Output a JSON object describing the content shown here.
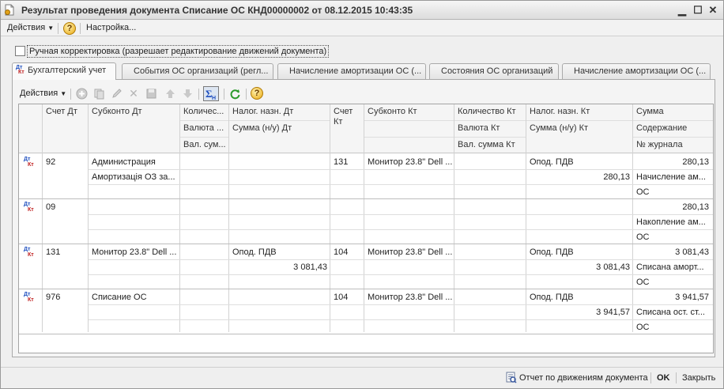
{
  "window": {
    "title": "Результат проведения документа Списание ОС КНД00000002 от 08.12.2015 10:43:35"
  },
  "menubar": {
    "actions_label": "Действия",
    "settings_label": "Настройка..."
  },
  "manual_edit": {
    "label": "Ручная корректировка (разрешает редактирование движений документа)",
    "checked": false
  },
  "tabs": [
    {
      "label": "Бухгалтерский учет",
      "active": true
    },
    {
      "label": "События ОС организаций (регл...",
      "active": false
    },
    {
      "label": "Начисление амортизации ОС (...",
      "active": false
    },
    {
      "label": "Состояния ОС организаций",
      "active": false
    },
    {
      "label": "Начисление амортизации ОС (...",
      "active": false
    }
  ],
  "toolbar": {
    "actions_label": "Действия"
  },
  "table": {
    "headers": {
      "schet_dt": "Счет Дт",
      "subkonto_dt": "Субконто Дт",
      "kolichestvo_dt": "Количес...",
      "valyuta_dt": "Валюта ...",
      "val_summa_dt": "Вал. сум...",
      "nalog_dt": "Налог. назн. Дт",
      "summa_nu_dt": "Сумма (н/у) Дт",
      "schet_kt_1": "Счет",
      "schet_kt_2": "Кт",
      "subkonto_kt": "Субконто Кт",
      "kolichestvo_kt": "Количество Кт",
      "valyuta_kt": "Валюта Кт",
      "val_summa_kt": "Вал. сумма Кт",
      "nalog_kt": "Налог. назн. Кт",
      "summa_nu_kt": "Сумма (н/у) Кт",
      "summa": "Сумма",
      "soderzhanie": "Содержание",
      "nomer_zhurnala": "№ журнала"
    },
    "rows": [
      {
        "schet_dt": "92",
        "subkonto_dt_1": "Администрация",
        "subkonto_dt_2": "Амортизація ОЗ за...",
        "nalog_dt": "",
        "summa_nu_dt": "",
        "schet_kt": "131",
        "subkonto_kt": "Монитор 23.8\" Dell ...",
        "nalog_kt": "Опод. ПДВ",
        "summa_nu_kt": "280,13",
        "summa": "280,13",
        "soderzhanie": "Начисление ам...",
        "zhurnal": "ОС"
      },
      {
        "schet_dt": "09",
        "subkonto_dt_1": "",
        "subkonto_dt_2": "",
        "nalog_dt": "",
        "summa_nu_dt": "",
        "schet_kt": "",
        "subkonto_kt": "",
        "nalog_kt": "",
        "summa_nu_kt": "",
        "summa": "280,13",
        "soderzhanie": "Накопление ам...",
        "zhurnal": "ОС"
      },
      {
        "schet_dt": "131",
        "subkonto_dt_1": "Монитор 23.8\" Dell ...",
        "subkonto_dt_2": "",
        "nalog_dt": "Опод. ПДВ",
        "summa_nu_dt": "3 081,43",
        "schet_kt": "104",
        "subkonto_kt": "Монитор 23.8\" Dell ...",
        "nalog_kt": "Опод. ПДВ",
        "summa_nu_kt": "3 081,43",
        "summa": "3 081,43",
        "soderzhanie": "Списана аморт...",
        "zhurnal": "ОС"
      },
      {
        "schet_dt": "976",
        "subkonto_dt_1": "Списание ОС",
        "subkonto_dt_2": "",
        "nalog_dt": "",
        "summa_nu_dt": "",
        "schet_kt": "104",
        "subkonto_kt": "Монитор 23.8\" Dell ...",
        "nalog_kt": "Опод. ПДВ",
        "summa_nu_kt": "3 941,57",
        "summa": "3 941,57",
        "soderzhanie": "Списана ост. ст...",
        "zhurnal": "ОС"
      }
    ]
  },
  "statusbar": {
    "report_label": "Отчет по движениям документа",
    "ok_label": "OK",
    "close_label": "Закрыть"
  },
  "icons": [
    "document-icon",
    "minimize-icon",
    "maximize-icon",
    "close-icon",
    "help-icon",
    "add-icon",
    "copy-icon",
    "edit-icon",
    "delete-icon",
    "save-icon",
    "move-up-icon",
    "move-down-icon",
    "sum-icon",
    "refresh-icon",
    "dt-kt-icon",
    "report-icon"
  ]
}
